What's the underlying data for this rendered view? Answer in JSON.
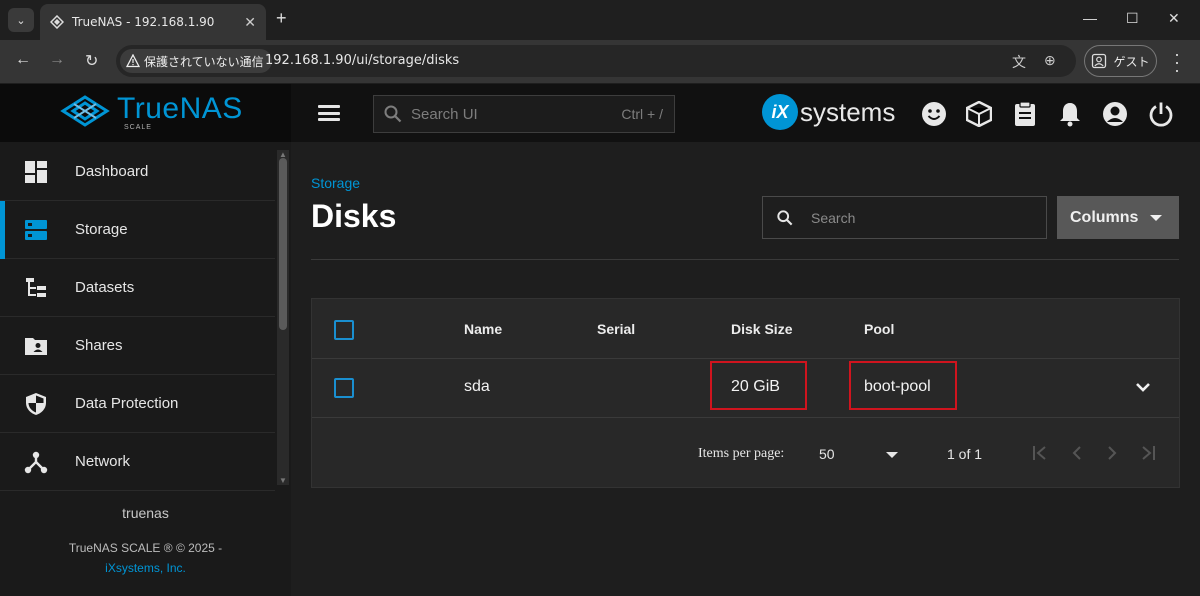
{
  "browser": {
    "tab_title": "TrueNAS - 192.168.1.90",
    "security_label": "保護されていない通信",
    "url": "192.168.1.90/ui/storage/disks",
    "profile_label": "ゲスト"
  },
  "header": {
    "logo": "TrueNAS",
    "logo_sub": "SCALE",
    "search_placeholder": "Search UI",
    "search_shortcut": "Ctrl + /",
    "vendor_ix": "iX",
    "vendor_text": "systems"
  },
  "sidebar": {
    "items": [
      {
        "label": "Dashboard",
        "icon": "dashboard-icon"
      },
      {
        "label": "Storage",
        "icon": "storage-icon"
      },
      {
        "label": "Datasets",
        "icon": "datasets-icon"
      },
      {
        "label": "Shares",
        "icon": "shares-icon"
      },
      {
        "label": "Data Protection",
        "icon": "shield-icon"
      },
      {
        "label": "Network",
        "icon": "network-icon"
      }
    ],
    "hostname": "truenas",
    "copyright": "TrueNAS SCALE ® © 2025 -",
    "company": "iXsystems, Inc."
  },
  "page": {
    "breadcrumb": "Storage",
    "title": "Disks",
    "search_placeholder": "Search",
    "columns_label": "Columns"
  },
  "table": {
    "headers": [
      "Name",
      "Serial",
      "Disk Size",
      "Pool"
    ],
    "rows": [
      {
        "name": "sda",
        "serial": "",
        "disk_size": "20 GiB",
        "pool": "boot-pool"
      }
    ],
    "items_per_page_label": "Items per page:",
    "items_per_page": "50",
    "range": "1 of 1"
  },
  "colors": {
    "accent": "#0095d5",
    "highlight": "#d0141e"
  }
}
